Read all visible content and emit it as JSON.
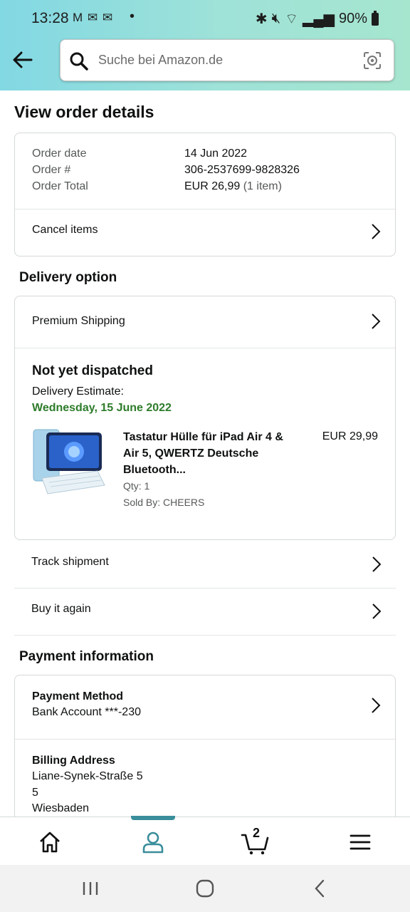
{
  "status_bar": {
    "time": "13:28",
    "notifications": "M ✉ ✉",
    "dot": "•",
    "battery": "90%"
  },
  "search": {
    "placeholder": "Suche bei Amazon.de"
  },
  "page": {
    "title": "View order details"
  },
  "order_summary": {
    "date_label": "Order date",
    "date_value": "14 Jun 2022",
    "number_label": "Order #",
    "number_value": "306-2537699-9828326",
    "total_label": "Order Total",
    "total_value": "EUR 26,99",
    "total_items": "(1 item)",
    "cancel_label": "Cancel items"
  },
  "delivery": {
    "section_title": "Delivery option",
    "option": "Premium Shipping",
    "status": "Not yet dispatched",
    "estimate_label": "Delivery Estimate:",
    "estimate_date": "Wednesday, 15 June 2022",
    "product": {
      "title": "Tastatur Hülle für iPad Air 4 & Air 5, QWERTZ Deutsche Bluetooth...",
      "qty": "Qty: 1",
      "seller": "Sold By: CHEERS",
      "price": "EUR 29,99"
    }
  },
  "actions": {
    "track": "Track shipment",
    "buy_again": "Buy it again"
  },
  "payment": {
    "section_title": "Payment information",
    "method_heading": "Payment Method",
    "method_value": "Bank Account ***-230",
    "billing_heading": "Billing Address",
    "billing_line1": "Liane-Synek-Straße 5",
    "billing_line2": "5",
    "billing_line3": "Wiesbaden"
  },
  "bottom_nav": {
    "cart_count": "2"
  },
  "colors": {
    "accent_green": "#2d7c2a",
    "nav_active": "#3a8e9b"
  },
  "icons": [
    "back-arrow-icon",
    "search-icon",
    "camera-icon",
    "chevron-right-icon",
    "home-icon",
    "profile-icon",
    "cart-icon",
    "menu-icon"
  ]
}
